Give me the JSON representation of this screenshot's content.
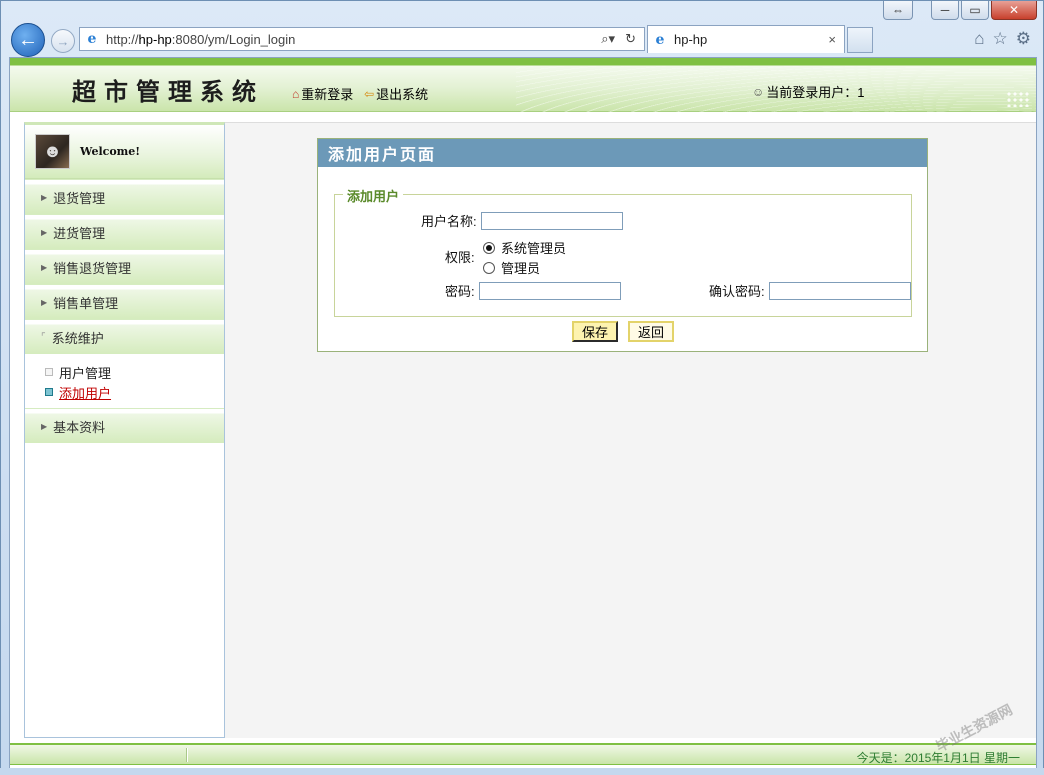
{
  "browser": {
    "address_prefix": "http://",
    "address_host": "hp-hp",
    "address_rest": ":8080/ym/Login_login",
    "tab_title": "hp-hp",
    "tab_close": "×"
  },
  "header": {
    "system_title": "超市管理系统",
    "relogin_label": "重新登录",
    "logout_label": "退出系统",
    "current_user_label": "当前登录用户：1"
  },
  "sidebar": {
    "welcome": "Welcome!",
    "items": [
      {
        "label": "退货管理"
      },
      {
        "label": "进货管理"
      },
      {
        "label": "销售退货管理"
      },
      {
        "label": "销售单管理"
      },
      {
        "label": "系统维护"
      },
      {
        "label": "基本资料"
      }
    ],
    "sub_items": [
      {
        "label": "用户管理"
      },
      {
        "label": "添加用户"
      }
    ]
  },
  "panel": {
    "title": "添加用户页面",
    "legend": "添加用户",
    "username_label": "用户名称:",
    "permission_label": "权限:",
    "role_options": [
      "系统管理员",
      "管理员"
    ],
    "password_label": "密码:",
    "confirm_password_label": "确认密码:",
    "save_label": "保存",
    "back_label": "返回"
  },
  "footer": {
    "date": "今天是：2015年1月1日 星期一"
  },
  "watermark": "毕业生资源网",
  "colors": {
    "header_green": "#7fc043",
    "panel_title_blue": "#6c99b8",
    "active_link_red": "#c00000"
  }
}
